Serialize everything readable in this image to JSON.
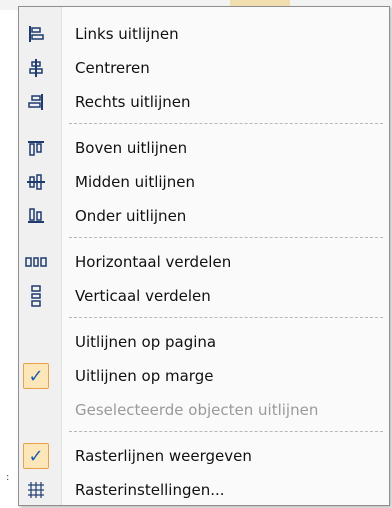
{
  "menu": {
    "items": [
      {
        "label": "Links uitlijnen",
        "icon": "align-left-icon"
      },
      {
        "label": "Centreren",
        "icon": "align-center-icon"
      },
      {
        "label": "Rechts uitlijnen",
        "icon": "align-right-icon"
      },
      {
        "label": "Boven uitlijnen",
        "icon": "align-top-icon"
      },
      {
        "label": "Midden uitlijnen",
        "icon": "align-middle-icon"
      },
      {
        "label": "Onder uitlijnen",
        "icon": "align-bottom-icon"
      },
      {
        "label": "Horizontaal verdelen",
        "icon": "distribute-horizontal-icon"
      },
      {
        "label": "Verticaal verdelen",
        "icon": "distribute-vertical-icon"
      },
      {
        "label": "Uitlijnen op pagina",
        "icon": ""
      },
      {
        "label": "Uitlijnen op marge",
        "icon": "checkmark-icon",
        "checked": true
      },
      {
        "label": "Geselecteerde objecten uitlijnen",
        "icon": "",
        "disabled": true
      },
      {
        "label": "Rasterlijnen weergeven",
        "icon": "checkmark-icon",
        "checked": true
      },
      {
        "label": "Rasterinstellingen...",
        "icon": "grid-icon"
      }
    ]
  },
  "colors": {
    "checked_bg": "#fde7b8",
    "checked_border": "#e8a34a",
    "disabled_text": "#9a9a9a"
  }
}
